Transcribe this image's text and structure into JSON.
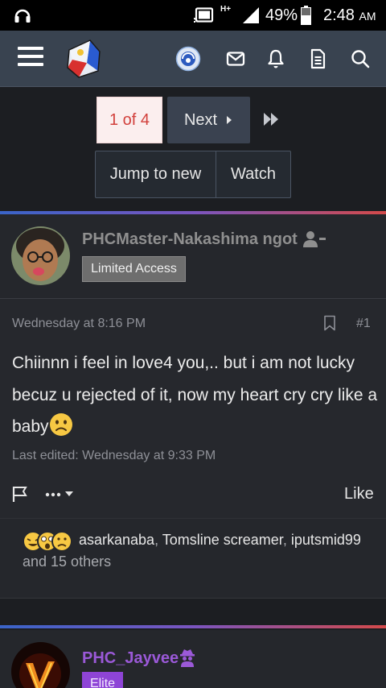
{
  "status_bar": {
    "network": "H+",
    "battery_percent": "49%",
    "time": "2:48",
    "ampm": "AM"
  },
  "header": {
    "icons": [
      "menu-icon",
      "site-logo",
      "community-icon",
      "mail-icon",
      "bell-icon",
      "document-icon",
      "search-icon"
    ]
  },
  "pager": {
    "current": "1 of 4",
    "next_label": "Next",
    "jump_label": "Jump to new",
    "watch_label": "Watch"
  },
  "posts": [
    {
      "username": "PHCMaster-Nakashima ngot",
      "badge": "Limited Access",
      "date": "Wednesday at 8:16 PM",
      "number": "#1",
      "message": "Chiinnn i feel in love4 you,.. but i am not lucky becuz u rejected of it, now my heart cry cry like a baby",
      "last_edited": "Last edited: Wednesday at 9:33 PM",
      "like_label": "Like",
      "reactions": {
        "names": [
          "asarkanaba",
          "Tomsline screamer",
          "iputsmid99"
        ],
        "separator": ", ",
        "others": "and 15 others"
      }
    },
    {
      "username": "PHC_Jayvee",
      "badge": "Elite"
    }
  ],
  "colors": {
    "accent_red": "#d2403c",
    "elite_purple": "#9b59d8",
    "header_bg": "#394350"
  }
}
